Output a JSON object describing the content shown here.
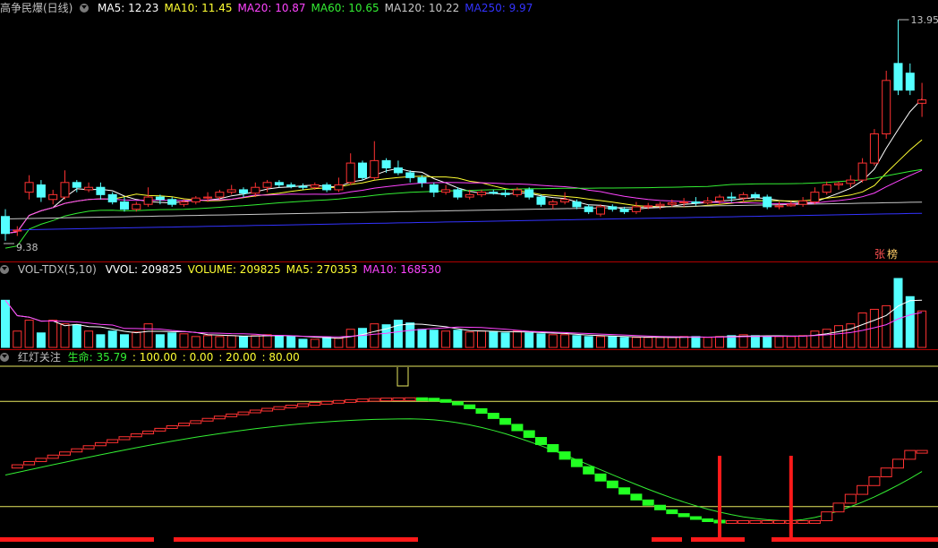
{
  "price_panel": {
    "title": "高争民爆(日线)",
    "ma": [
      {
        "label": "MA5: 12.23",
        "color": "#ffffff"
      },
      {
        "label": "MA10: 11.45",
        "color": "#ffff33"
      },
      {
        "label": "MA20: 10.87",
        "color": "#ff44ff"
      },
      {
        "label": "MA60: 10.65",
        "color": "#33ee33"
      },
      {
        "label": "MA120: 10.22",
        "color": "#c8c8c8"
      },
      {
        "label": "MA250: 9.97",
        "color": "#3333ff"
      }
    ],
    "high_label": "13.95",
    "low_label": "9.38",
    "badge1": "张",
    "badge2": "榜"
  },
  "volume_panel": {
    "name": "VOL-TDX(5,10)",
    "items": [
      {
        "label": "VVOL: 209825",
        "color": "#ffffff"
      },
      {
        "label": "VOLUME: 209825",
        "color": "#ffff33"
      },
      {
        "label": "MA5: 270353",
        "color": "#ffff33"
      },
      {
        "label": "MA10: 168530",
        "color": "#ff44ff"
      }
    ]
  },
  "indicator_panel": {
    "name": "红灯关注",
    "items": [
      {
        "label": "生命: 35.79",
        "color": "#33ee33"
      },
      {
        "label": ": 100.00",
        "color": "#ffff33"
      },
      {
        "label": ": 0.00",
        "color": "#ffff33"
      },
      {
        "label": ": 20.00",
        "color": "#ffff33"
      },
      {
        "label": ": 80.00",
        "color": "#ffff33"
      }
    ]
  },
  "colors": {
    "up": "#ff3232",
    "down": "#54ffff",
    "ma5": "#ffffff",
    "ma10": "#ffff33",
    "ma20": "#ff44ff",
    "ma60": "#33ee33",
    "ma120": "#c8c8c8",
    "ma250": "#3333ff"
  },
  "chart_data": {
    "type": "candlestick",
    "y_range": [
      9.38,
      13.95
    ],
    "candles": [
      [
        9.9,
        9.55,
        10.05,
        9.4
      ],
      [
        9.6,
        9.62,
        9.7,
        9.5
      ],
      [
        10.4,
        10.6,
        10.75,
        10.25
      ],
      [
        10.55,
        10.3,
        10.65,
        10.2
      ],
      [
        10.25,
        10.35,
        10.45,
        10.15
      ],
      [
        10.3,
        10.6,
        10.85,
        10.25
      ],
      [
        10.6,
        10.5,
        10.65,
        10.4
      ],
      [
        10.45,
        10.5,
        10.6,
        10.4
      ],
      [
        10.5,
        10.35,
        10.6,
        10.25
      ],
      [
        10.35,
        10.2,
        10.4,
        10.15
      ],
      [
        10.2,
        10.05,
        10.3,
        10.0
      ],
      [
        10.05,
        10.15,
        10.2,
        10.0
      ],
      [
        10.15,
        10.3,
        10.5,
        10.1
      ],
      [
        10.3,
        10.25,
        10.35,
        10.15
      ],
      [
        10.25,
        10.15,
        10.3,
        10.1
      ],
      [
        10.15,
        10.2,
        10.25,
        10.1
      ],
      [
        10.2,
        10.28,
        10.32,
        10.15
      ],
      [
        10.28,
        10.3,
        10.4,
        10.2
      ],
      [
        10.3,
        10.4,
        10.45,
        10.25
      ],
      [
        10.4,
        10.45,
        10.55,
        10.35
      ],
      [
        10.45,
        10.38,
        10.5,
        10.3
      ],
      [
        10.38,
        10.5,
        10.6,
        10.3
      ],
      [
        10.5,
        10.6,
        10.65,
        10.4
      ],
      [
        10.6,
        10.55,
        10.65,
        10.5
      ],
      [
        10.55,
        10.52,
        10.6,
        10.48
      ],
      [
        10.52,
        10.5,
        10.58,
        10.45
      ],
      [
        10.5,
        10.55,
        10.6,
        10.45
      ],
      [
        10.55,
        10.45,
        10.6,
        10.4
      ],
      [
        10.45,
        10.55,
        10.7,
        10.4
      ],
      [
        10.6,
        11.0,
        11.2,
        10.55
      ],
      [
        11.0,
        10.7,
        11.05,
        10.65
      ],
      [
        10.7,
        11.05,
        11.45,
        10.65
      ],
      [
        11.05,
        10.9,
        11.1,
        10.8
      ],
      [
        10.9,
        10.8,
        11.05,
        10.75
      ],
      [
        10.8,
        10.7,
        10.85,
        10.6
      ],
      [
        10.7,
        10.6,
        10.75,
        10.5
      ],
      [
        10.55,
        10.4,
        10.6,
        10.3
      ],
      [
        10.4,
        10.45,
        10.55,
        10.35
      ],
      [
        10.45,
        10.3,
        10.5,
        10.25
      ],
      [
        10.3,
        10.35,
        10.45,
        10.25
      ],
      [
        10.35,
        10.4,
        10.45,
        10.3
      ],
      [
        10.4,
        10.38,
        10.45,
        10.35
      ],
      [
        10.38,
        10.35,
        10.45,
        10.3
      ],
      [
        10.35,
        10.45,
        10.5,
        10.3
      ],
      [
        10.45,
        10.3,
        10.5,
        10.25
      ],
      [
        10.3,
        10.15,
        10.35,
        10.1
      ],
      [
        10.15,
        10.2,
        10.25,
        10.05
      ],
      [
        10.2,
        10.25,
        10.4,
        10.15
      ],
      [
        10.2,
        10.1,
        10.25,
        10.05
      ],
      [
        10.1,
        10.0,
        10.15,
        9.95
      ],
      [
        9.95,
        10.1,
        10.15,
        9.9
      ],
      [
        10.1,
        10.05,
        10.15,
        10.0
      ],
      [
        10.05,
        10.0,
        10.1,
        9.95
      ],
      [
        10.0,
        10.1,
        10.2,
        9.95
      ],
      [
        10.1,
        10.12,
        10.18,
        10.05
      ],
      [
        10.12,
        10.15,
        10.2,
        10.05
      ],
      [
        10.15,
        10.18,
        10.25,
        10.1
      ],
      [
        10.18,
        10.2,
        10.28,
        10.1
      ],
      [
        10.2,
        10.18,
        10.3,
        10.12
      ],
      [
        10.18,
        10.22,
        10.3,
        10.15
      ],
      [
        10.22,
        10.3,
        10.35,
        10.15
      ],
      [
        10.3,
        10.28,
        10.4,
        10.2
      ],
      [
        10.28,
        10.35,
        10.4,
        10.2
      ],
      [
        10.35,
        10.3,
        10.4,
        10.25
      ],
      [
        10.3,
        10.1,
        10.35,
        10.05
      ],
      [
        10.1,
        10.12,
        10.2,
        10.05
      ],
      [
        10.12,
        10.15,
        10.22,
        10.1
      ],
      [
        10.15,
        10.22,
        10.3,
        10.1
      ],
      [
        10.2,
        10.4,
        10.5,
        10.15
      ],
      [
        10.4,
        10.55,
        10.62,
        10.35
      ],
      [
        10.55,
        10.58,
        10.62,
        10.45
      ],
      [
        10.58,
        10.65,
        10.75,
        10.5
      ],
      [
        10.65,
        11.0,
        11.1,
        10.6
      ],
      [
        11.0,
        11.6,
        11.7,
        10.95
      ],
      [
        11.6,
        12.7,
        12.9,
        11.5
      ],
      [
        13.05,
        12.5,
        13.95,
        12.4
      ],
      [
        12.85,
        12.5,
        13.05,
        12.4
      ],
      [
        12.23,
        12.3,
        12.65,
        11.95
      ]
    ],
    "volume": [
      520,
      180,
      300,
      160,
      300,
      260,
      250,
      180,
      140,
      180,
      140,
      170,
      260,
      140,
      160,
      150,
      120,
      130,
      120,
      130,
      120,
      130,
      140,
      130,
      120,
      90,
      90,
      110,
      100,
      200,
      210,
      260,
      250,
      300,
      270,
      200,
      190,
      180,
      190,
      170,
      180,
      170,
      160,
      180,
      160,
      150,
      140,
      140,
      130,
      120,
      120,
      120,
      110,
      110,
      110,
      110,
      110,
      120,
      120,
      110,
      120,
      130,
      140,
      130,
      120,
      120,
      120,
      130,
      180,
      200,
      240,
      260,
      380,
      420,
      460,
      760,
      560,
      402
    ],
    "ma_overlay": {
      "ma5_end": 12.23,
      "ma10_end": 11.45,
      "ma20_end": 10.87,
      "ma60_end": 10.65,
      "ma120_end": 10.22,
      "ma250_end": 9.97
    }
  }
}
